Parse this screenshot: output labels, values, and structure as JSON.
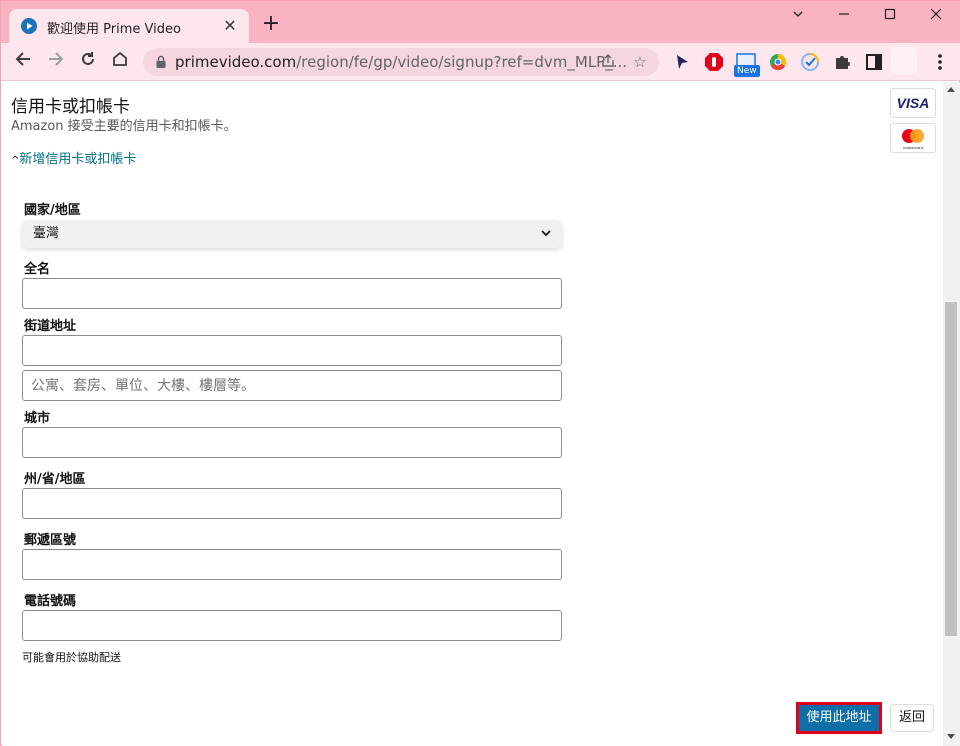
{
  "browser": {
    "tab_title": "歡迎使用 Prime Video",
    "new_tab_label": "+",
    "url_host": "primevideo.com",
    "url_path": "/region/fe/gp/video/signup?ref=dvm_MLP_...",
    "extension_new_badge": "New",
    "window_controls": {
      "minimize": "—",
      "maximize": "☐",
      "close": "✕"
    }
  },
  "page": {
    "title": "信用卡或扣帳卡",
    "subtitle": "Amazon 接受主要的信用卡和扣帳卡。",
    "add_card_link": "新增信用卡或扣帳卡",
    "card_logos": [
      "VISA",
      "mastercard"
    ],
    "form": {
      "country_label": "國家/地區",
      "country_value": "臺灣",
      "fullname_label": "全名",
      "fullname_value": "",
      "street_label": "街道地址",
      "street_value": "",
      "street2_placeholder": "公寓、套房、單位、大樓、樓層等。",
      "city_label": "城市",
      "city_value": "",
      "state_label": "州/省/地區",
      "state_value": "",
      "zip_label": "郵遞區號",
      "zip_value": "",
      "phone_label": "電話號碼",
      "phone_value": "",
      "phone_hint": "可能會用於協助配送"
    },
    "buttons": {
      "use_address": "使用此地址",
      "back": "返回"
    }
  },
  "colors": {
    "tabstrip": "#f9b3c2",
    "toolbar": "#fde7ec",
    "link": "#007185",
    "primary_button": "#0f6fa9",
    "highlight_border": "#e3001b"
  }
}
